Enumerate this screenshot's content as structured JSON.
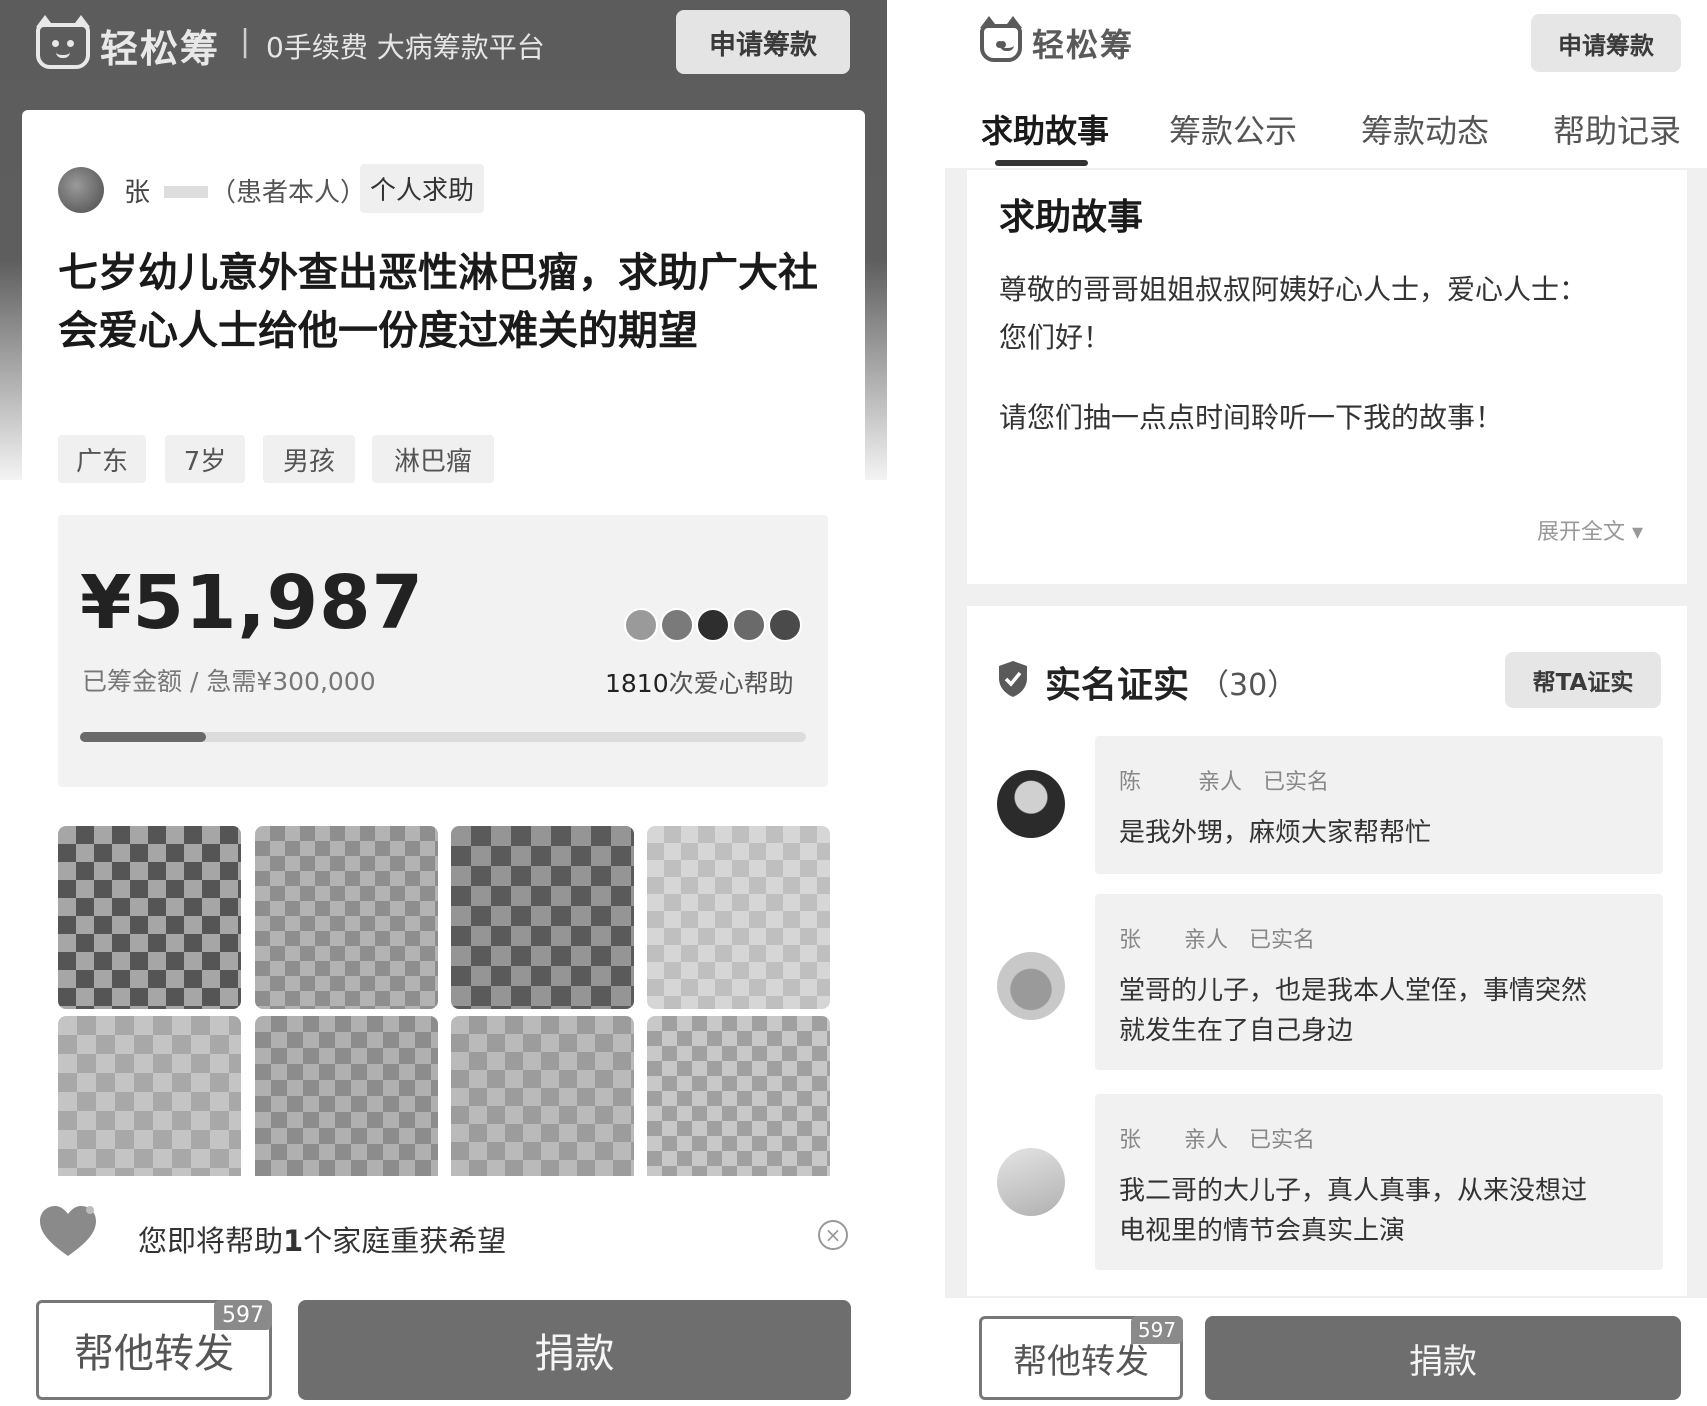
{
  "left": {
    "header": {
      "logo_text": "轻松筹",
      "divider": "|",
      "slogan": "0手续费 大病筹款平台",
      "apply_button": "申请筹款"
    },
    "author": {
      "name": "张",
      "role": "（患者本人）",
      "type_tag": "个人求助"
    },
    "title": "七岁幼儿意外查出恶性淋巴瘤，求助广大社会爱心人士给他一份度过难关的期望",
    "tags": [
      "广东",
      "7岁",
      "男孩",
      "淋巴瘤"
    ],
    "progress": {
      "amount": "¥51,987",
      "caption": "已筹金额 / 急需¥300,000",
      "fraction": 0.173,
      "help_count": "1810",
      "help_label": "次爱心帮助"
    },
    "banner": {
      "text_pre": "您即将帮助",
      "text_num": "1",
      "text_post": "个家庭重获希望"
    },
    "share_button": "帮他转发",
    "share_badge": "597",
    "donate_button": "捐款"
  },
  "right": {
    "header": {
      "logo_text": "轻松筹",
      "apply_button": "申请筹款"
    },
    "tabs": [
      "求助故事",
      "筹款公示",
      "筹款动态",
      "帮助记录"
    ],
    "story": {
      "heading": "求助故事",
      "line1": "尊敬的哥哥姐姐叔叔阿姨好心人士，爱心人士：",
      "line2": "您们好！",
      "line3": "请您们抽一点点时间聆听一下我的故事！",
      "expand": "展开全文 ▾"
    },
    "verify": {
      "heading": "实名证实",
      "count": "（30）",
      "button": "帮TA证实",
      "items": [
        {
          "name": "陈",
          "relation": "亲人",
          "status": "已实名",
          "text1": "是我外甥，麻烦大家帮帮忙",
          "text2": ""
        },
        {
          "name": "张",
          "relation": "亲人",
          "status": "已实名",
          "text1": "堂哥的儿子，也是我本人堂侄，事情突然",
          "text2": "就发生在了自己身边"
        },
        {
          "name": "张",
          "relation": "亲人",
          "status": "已实名",
          "text1": "我二哥的大儿子，真人真事，从来没想过",
          "text2": "电视里的情节会真实上演"
        }
      ]
    },
    "share_button": "帮他转发",
    "share_badge": "597",
    "donate_button": "捐款"
  }
}
